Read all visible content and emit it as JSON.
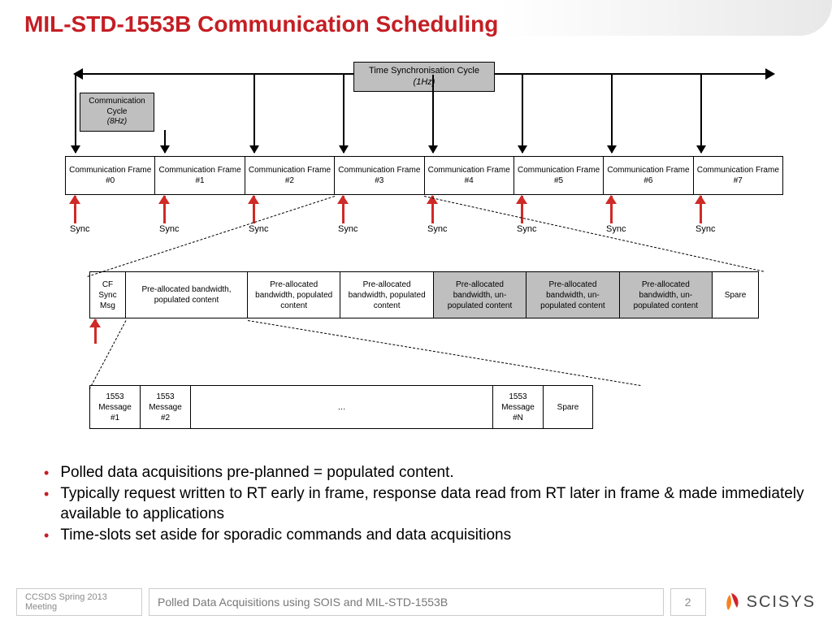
{
  "title": "MIL-STD-1553B Communication Scheduling",
  "tsc": {
    "line1": "Time Synchronisation Cycle",
    "line2": "(1Hz)"
  },
  "cc": {
    "line1": "Communication",
    "line2": "Cycle",
    "line3": "(8Hz)"
  },
  "frames": [
    "Communication Frame #0",
    "Communication Frame #1",
    "Communication Frame #2",
    "Communication Frame #3",
    "Communication Frame #4",
    "Communication Frame #5",
    "Communication Frame #6",
    "Communication Frame #7"
  ],
  "sync": "Sync",
  "bw": {
    "cf": "CF Sync Msg",
    "pop": "Pre-allocated bandwidth, populated content",
    "unpop": "Pre-allocated bandwidth, un-populated content",
    "spare": "Spare"
  },
  "msgs": {
    "m1": "1553 Message #1",
    "m2": "1553 Message #2",
    "dots": "…",
    "mn": "1553 Message #N",
    "spare": "Spare"
  },
  "bullets": [
    "Polled data acquisitions pre-planned = populated content.",
    "Typically request written to RT early in frame, response data read from RT later in frame & made immediately available to applications",
    "Time-slots set aside for sporadic commands and data acquisitions"
  ],
  "footer": {
    "meeting": "CCSDS Spring 2013 Meeting",
    "doc": "Polled Data Acquisitions using SOIS and MIL-STD-1553B",
    "page": "2",
    "company": "SCISYS"
  }
}
